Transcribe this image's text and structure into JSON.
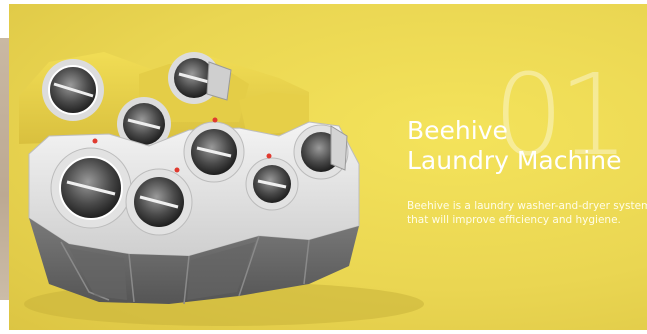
{
  "slide": {
    "number": "01",
    "title_line1": "Beehive",
    "title_line2": "Laundry Machine",
    "description_line1": "Beehive is a laundry washer-and-dryer system",
    "description_line2": "that will improve efficiency and hygiene."
  },
  "colors": {
    "background": "#ecd854",
    "machine_yellow": "#e8d24a",
    "machine_body": "#e9e9e9",
    "machine_base": "#6f6f6f",
    "text": "#ffffff"
  }
}
